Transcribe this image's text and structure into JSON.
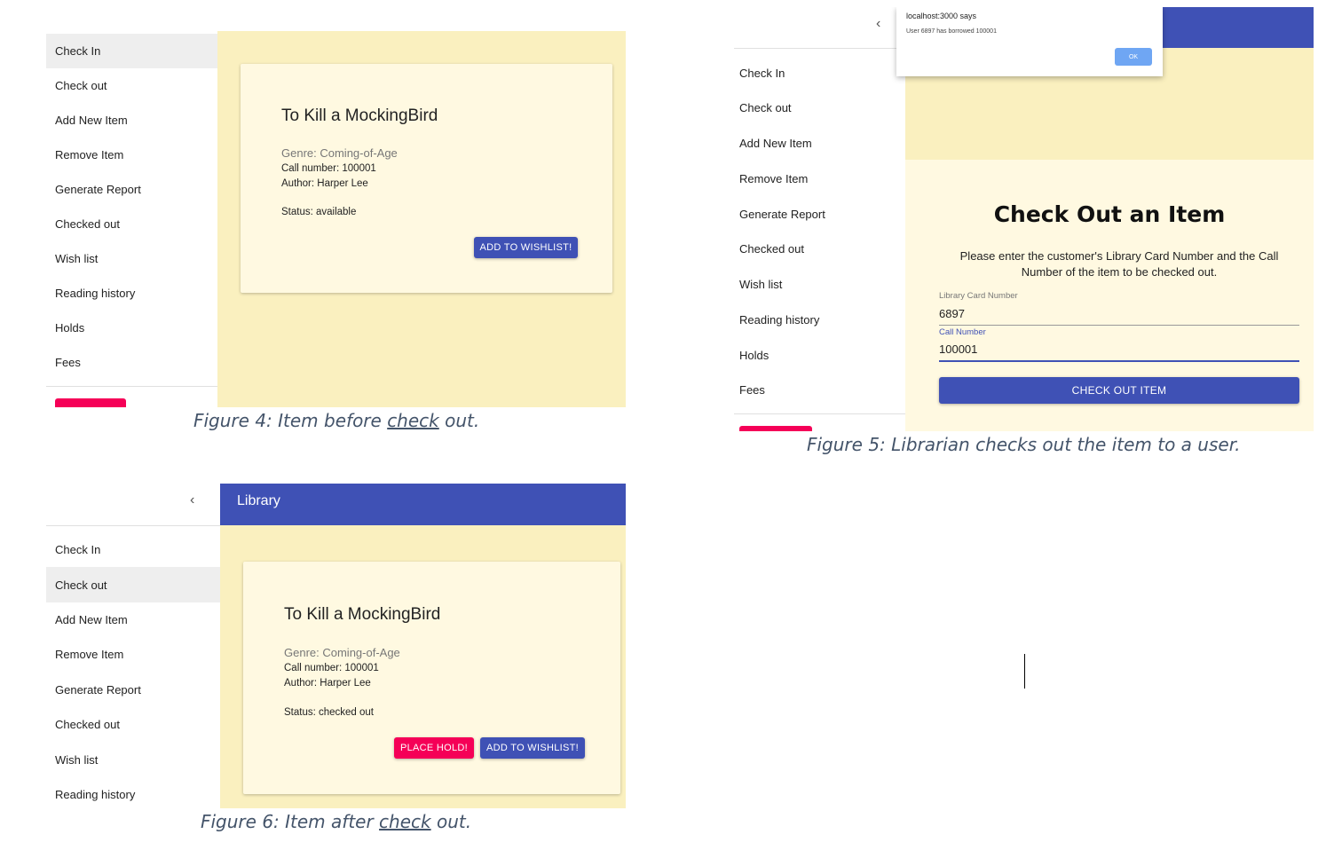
{
  "nav_items": [
    "Check In",
    "Check out",
    "Add New Item",
    "Remove Item",
    "Generate Report",
    "Checked out",
    "Wish list",
    "Reading history",
    "Holds",
    "Fees"
  ],
  "book": {
    "title": "To Kill a MockingBird",
    "genre": "Genre: Coming-of-Age",
    "call_number": "Call number: 100001",
    "author": "Author: Harper Lee"
  },
  "figure4": {
    "status": "Status: available",
    "wishlist_button": "ADD TO WISHLIST!",
    "caption_pre": "Figure 4: Item before ",
    "caption_link": "check",
    "caption_post": " out."
  },
  "figure5": {
    "alert_title": "localhost:3000 says",
    "alert_message": "User 6897 has borrowed 100001",
    "alert_ok": "OK",
    "heading": "Check Out an Item",
    "instructions": "Please enter the customer's Library Card Number and the Call Number of the item to be checked out.",
    "card_label": "Library Card Number",
    "card_value": "6897",
    "call_label": "Call Number",
    "call_value": "100001",
    "submit_button": "CHECK OUT ITEM",
    "caption": "Figure 5: Librarian checks out the item to a user."
  },
  "figure6": {
    "appbar_title": "Library",
    "status": "Status: checked out",
    "hold_button": "PLACE HOLD!",
    "wishlist_button": "ADD TO WISHLIST!",
    "caption_pre": "Figure 6: Item after ",
    "caption_link": "check",
    "caption_post": " out."
  },
  "colors": {
    "primary": "#3f51b5",
    "secondary": "#f50057",
    "panel": "#faf0bf",
    "card": "#fff9e1"
  },
  "icons": [
    "chevron-left-icon"
  ]
}
